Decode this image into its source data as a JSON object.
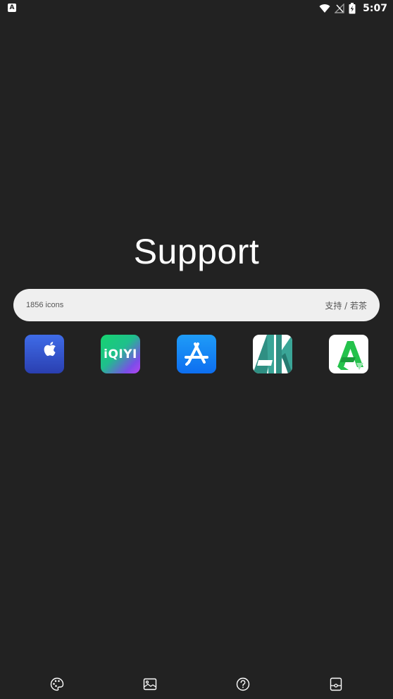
{
  "status_bar": {
    "notification_icon": "a-notification-icon",
    "notification_glyph": "A",
    "icons": [
      "wifi-icon",
      "no-signal-icon",
      "battery-charging-icon"
    ],
    "time": "5:07"
  },
  "main": {
    "title": "Support",
    "search": {
      "count_text": "1856 icons",
      "tags_text": "支持 / 若茶"
    },
    "apps": [
      {
        "icon": "apple-icon",
        "name": "Apple"
      },
      {
        "icon": "iqiyi-icon",
        "label": "iQIYI"
      },
      {
        "icon": "app-store-icon",
        "name": "App Store"
      },
      {
        "icon": "ak-icon",
        "name": "AK"
      },
      {
        "icon": "apkpure-icon",
        "name": "APKPure"
      }
    ]
  },
  "bottom_nav": {
    "items": [
      "palette-icon",
      "wallpaper-icon",
      "help-icon",
      "widget-icon"
    ]
  },
  "colors": {
    "background": "#222222",
    "search_bar": "#efefef",
    "text_primary": "#ffffff"
  }
}
